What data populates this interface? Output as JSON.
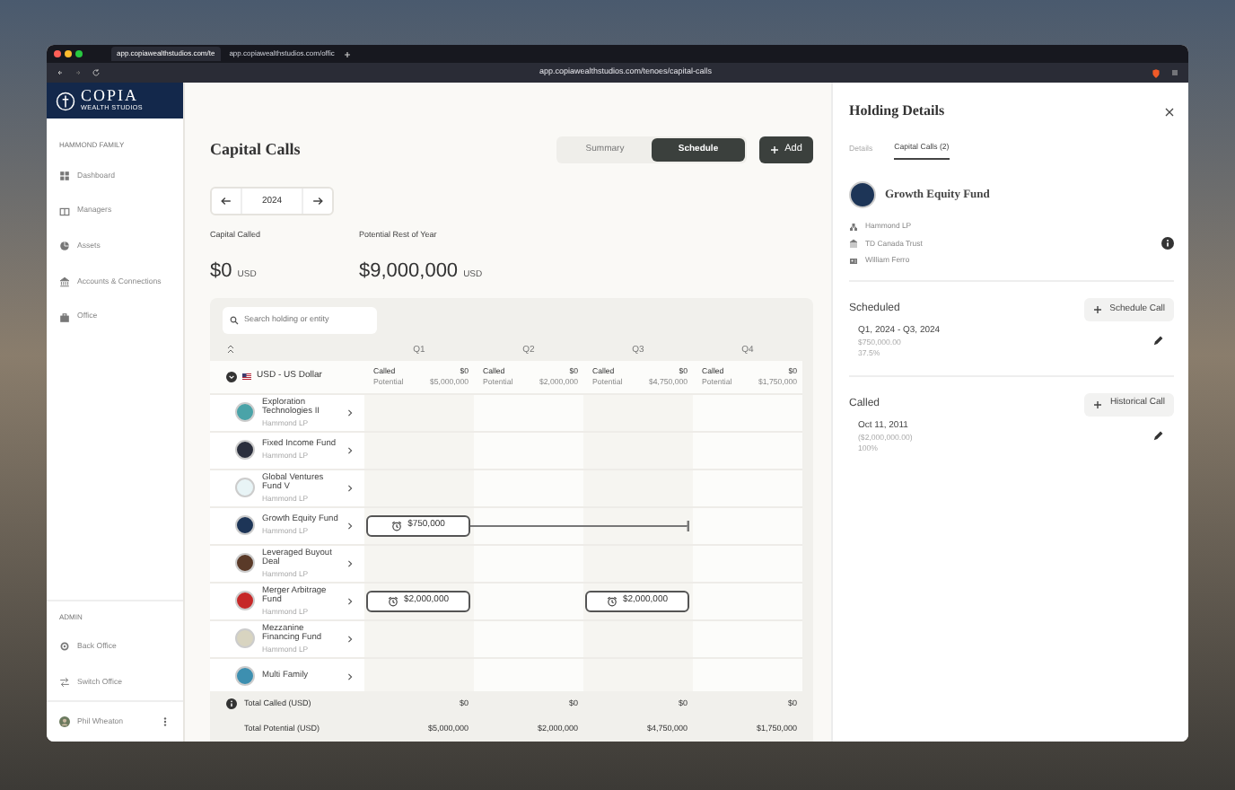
{
  "browser": {
    "tabs": [
      {
        "title": "app.copiawealthstudios.com/te",
        "selected": true
      },
      {
        "title": "app.copiawealthstudios.com/offic",
        "selected": false
      }
    ],
    "url": "app.copiawealthstudios.com/tenoes/capital-calls"
  },
  "sidebar": {
    "logo": {
      "name": "COPIA",
      "tagline": "WEALTH STUDIOS"
    },
    "section": "HAMMOND FAMILY",
    "items": [
      "Dashboard",
      "Managers",
      "Assets",
      "Accounts & Connections",
      "Office"
    ],
    "admin_section": "ADMIN",
    "admin_items": [
      "Back Office",
      "Switch Office"
    ],
    "user": "Phil Wheaton"
  },
  "main": {
    "title": "Capital Calls",
    "view_toggle": [
      {
        "label": "Summary",
        "selected": false
      },
      {
        "label": "Schedule",
        "selected": true
      }
    ],
    "add_button": "Add",
    "year": "2024",
    "stats": [
      {
        "label": "Capital Called",
        "value": "$0",
        "unit": "USD"
      },
      {
        "label": "Potential Rest of Year",
        "value": "$9,000,000",
        "unit": "USD"
      }
    ],
    "search": {
      "placeholder": "Search holding or entity"
    },
    "quarters": [
      "Q1",
      "Q2",
      "Q3",
      "Q4"
    ],
    "group": {
      "name": "USD - US Dollar",
      "expanded": true,
      "quarters": [
        {
          "called_label": "Called",
          "called": "$0",
          "potential_label": "Potential",
          "potential": "$5,000,000"
        },
        {
          "called_label": "Called",
          "called": "$0",
          "potential_label": "Potential",
          "potential": "$2,000,000"
        },
        {
          "called_label": "Called",
          "called": "$0",
          "potential_label": "Potential",
          "potential": "$4,750,000"
        },
        {
          "called_label": "Called",
          "called": "$0",
          "potential_label": "Potential",
          "potential": "$1,750,000"
        }
      ]
    },
    "holdings": [
      {
        "name": "Exploration Technologies II",
        "entity": "Hammond LP",
        "color": "#4aa3a8"
      },
      {
        "name": "Fixed Income Fund",
        "entity": "Hammond LP",
        "color": "#2b2f3d"
      },
      {
        "name": "Global Ventures Fund V",
        "entity": "Hammond LP",
        "color": "#e8f4f6"
      },
      {
        "name": "Growth Equity Fund",
        "entity": "Hammond LP",
        "color": "#1d3557",
        "timeline": [
          {
            "kind": "call",
            "amount": "$750,000"
          },
          {
            "kind": "range"
          },
          {
            "kind": "range_end"
          },
          {
            "kind": "empty"
          }
        ]
      },
      {
        "name": "Leveraged Buyout Deal",
        "entity": "Hammond LP",
        "color": "#5a3a28"
      },
      {
        "name": "Merger Arbitrage Fund",
        "entity": "Hammond LP",
        "color": "#c62828",
        "timeline": [
          {
            "kind": "call",
            "amount": "$2,000,000"
          },
          {
            "kind": "empty"
          },
          {
            "kind": "call",
            "amount": "$2,000,000"
          },
          {
            "kind": "empty"
          }
        ]
      },
      {
        "name": "Mezzanine Financing Fund",
        "entity": "Hammond LP",
        "color": "#d8d4c0"
      },
      {
        "name": "Multi Family",
        "color": "#3d8fb0"
      }
    ],
    "totals": [
      {
        "label": "Total Called (USD)",
        "values": [
          "$0",
          "$0",
          "$0",
          "$0"
        ]
      },
      {
        "label": "Total Potential (USD)",
        "values": [
          "$5,000,000",
          "$2,000,000",
          "$4,750,000",
          "$1,750,000"
        ]
      }
    ]
  },
  "details": {
    "title": "Holding Details",
    "tabs": [
      {
        "label": "Details",
        "selected": false
      },
      {
        "label": "Capital Calls (2)",
        "selected": true
      }
    ],
    "holding": {
      "name": "Growth Equity Fund",
      "color": "#1d3557",
      "meta": [
        "Hammond LP",
        "TD Canada Trust",
        "William Ferro"
      ]
    },
    "sections": [
      {
        "title": "Scheduled",
        "action": "Schedule Call",
        "entries": [
          {
            "title": "Q1, 2024 - Q3, 2024",
            "amount": "$750,000.00",
            "percent": "37.5%"
          }
        ]
      },
      {
        "title": "Called",
        "action": "Historical Call",
        "entries": [
          {
            "title": "Oct 11, 2011",
            "amount": "($2,000,000.00)",
            "percent": "100%"
          }
        ]
      }
    ]
  }
}
